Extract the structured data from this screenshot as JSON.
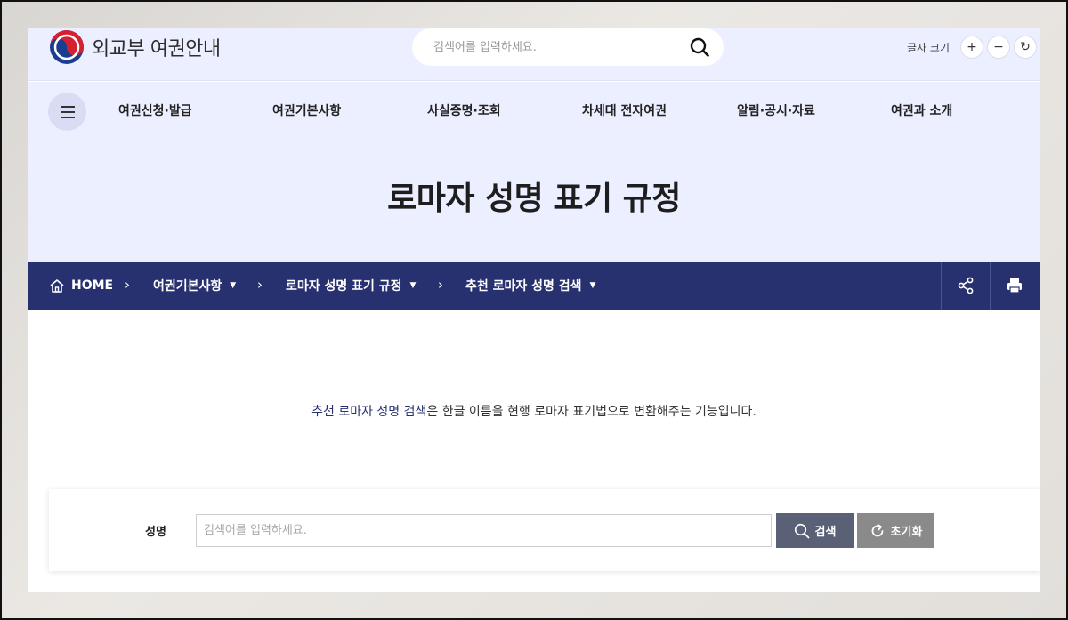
{
  "header": {
    "logo_text": "외교부 여권안내",
    "search_placeholder": "검색어를 입력하세요.",
    "font_size_label": "글자 크기",
    "font_plus": "+",
    "font_minus": "−",
    "font_reset": "↻"
  },
  "nav": {
    "items": [
      {
        "label": "여권신청·발급"
      },
      {
        "label": "여권기본사항"
      },
      {
        "label": "사실증명·조회"
      },
      {
        "label": "차세대 전자여권"
      },
      {
        "label": "알림·공시·자료"
      },
      {
        "label": "여권과 소개"
      }
    ]
  },
  "hero": {
    "title": "로마자 성명 표기 규정"
  },
  "breadcrumb": {
    "home": "HOME",
    "level1": "여권기본사항",
    "level2": "로마자 성명 표기 규정",
    "level3": "추천 로마자 성명 검색"
  },
  "content": {
    "intro_highlight": "추천 로마자 성명 검색",
    "intro_rest": "은 한글 이름을 현행 로마자 표기법으로 변환해주는 기능입니다."
  },
  "form": {
    "label": "성명",
    "placeholder": "검색어를 입력하세요.",
    "search_button": "검색",
    "reset_button": "초기화"
  },
  "colors": {
    "nav_background": "#ecefff",
    "breadcrumb_background": "#283170",
    "search_button": "#5a6177",
    "reset_button": "#8a8a8a"
  }
}
